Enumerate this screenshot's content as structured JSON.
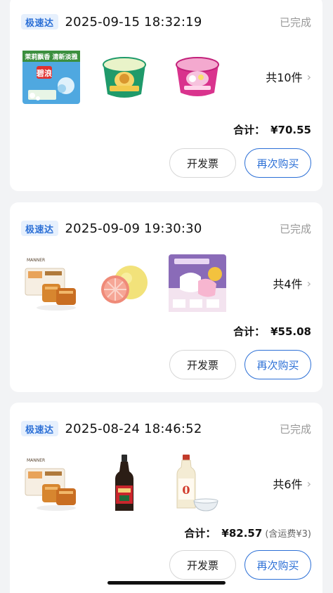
{
  "orders": [
    {
      "badge": "极速达",
      "time": "2025-09-15 18:32:19",
      "status": "已完成",
      "products": [
        "laundry-detergent",
        "instant-noodle-cup-green",
        "instant-noodle-cup-pink"
      ],
      "count_label": "共10件",
      "total_label": "合计：",
      "total_amount": "¥70.55",
      "shipping_note": "",
      "invoice_label": "开发票",
      "rebuy_label": "再次购买",
      "detergent_text": "茉莉飘香 清新淡雅"
    },
    {
      "badge": "极速达",
      "time": "2025-09-09 19:30:30",
      "status": "已完成",
      "products": [
        "pastry-box",
        "pomelo",
        "pads-box"
      ],
      "count_label": "共4件",
      "total_label": "合计：",
      "total_amount": "¥55.08",
      "shipping_note": "",
      "invoice_label": "开发票",
      "rebuy_label": "再次购买"
    },
    {
      "badge": "极速达",
      "time": "2025-08-24 18:46:52",
      "status": "已完成",
      "products": [
        "pastry-box",
        "soy-sauce-bottle",
        "vinegar-bottle"
      ],
      "count_label": "共6件",
      "total_label": "合计：",
      "total_amount": "¥82.57",
      "shipping_note": "(含运费¥3)",
      "invoice_label": "开发票",
      "rebuy_label": "再次购买"
    }
  ],
  "colors": {
    "accent": "#2b6fd6",
    "badge_bg": "#e6f0fd",
    "status_gray": "#9a9a9a",
    "page_bg": "#f2f3f5"
  }
}
